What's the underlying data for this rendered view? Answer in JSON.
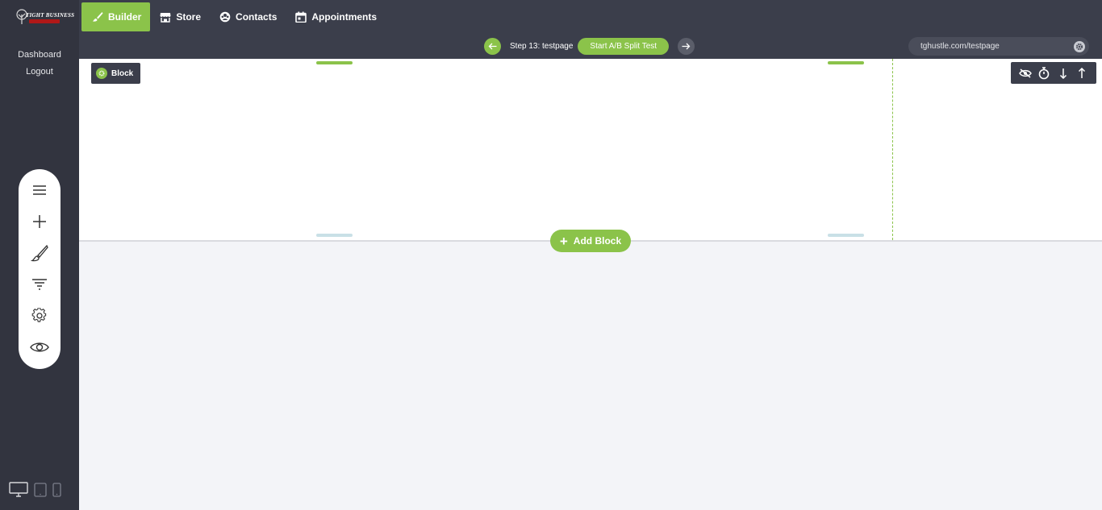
{
  "logo": {
    "text": "TIGHT BUSINESS"
  },
  "nav": {
    "items": [
      {
        "label": "Builder",
        "icon": "brush-icon",
        "active": true
      },
      {
        "label": "Store",
        "icon": "store-icon",
        "active": false
      },
      {
        "label": "Contacts",
        "icon": "contacts-icon",
        "active": false
      },
      {
        "label": "Appointments",
        "icon": "calendar-icon",
        "active": false
      }
    ]
  },
  "step": {
    "label": "Step 13: testpage",
    "split_label": "Start A/B Split Test"
  },
  "url": {
    "value": "tghustle.com/testpage"
  },
  "sidebar": {
    "dashboard": "Dashboard",
    "logout": "Logout"
  },
  "tools": [
    "menu-icon",
    "plus-icon",
    "brush-icon",
    "filter-icon",
    "gear-icon",
    "eye-icon"
  ],
  "block": {
    "tag_label": "Block",
    "add_label": "Add Block"
  },
  "colors": {
    "accent": "#8bc34a",
    "dark": "#3b3e4b",
    "darker": "#32343f",
    "canvas": "#f3f4f8"
  }
}
